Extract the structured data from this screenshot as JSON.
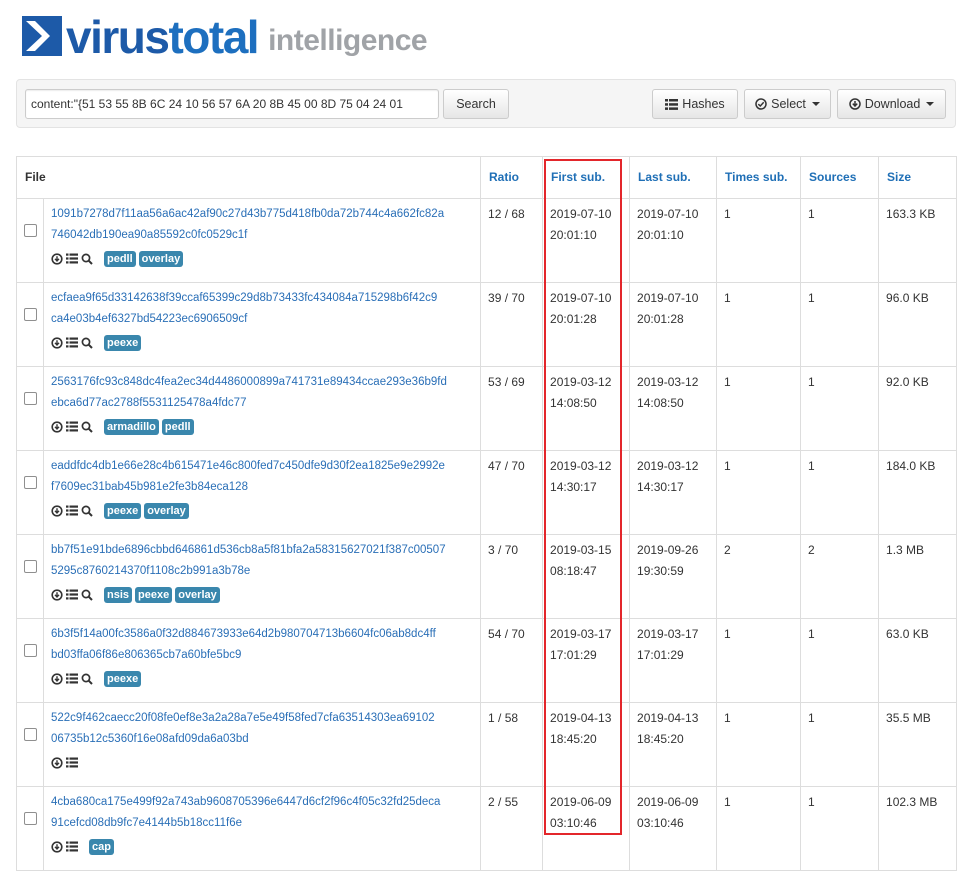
{
  "logo": {
    "brand_a": "virus",
    "brand_b": "total",
    "product": "intelligence"
  },
  "search": {
    "query": "content:\"{51 53 55 8B 6C 24 10 56 57 6A 20 8B 45 00 8D 75 04 24 01",
    "button_label": "Search"
  },
  "toolbar": {
    "hashes_label": "Hashes",
    "select_label": "Select",
    "download_label": "Download"
  },
  "table": {
    "headers": {
      "file": "File",
      "ratio": "Ratio",
      "first_sub": "First sub.",
      "last_sub": "Last sub.",
      "times_sub": "Times sub.",
      "sources": "Sources",
      "size": "Size"
    },
    "rows": [
      {
        "hash_line1": "1091b7278d7f11aa56a6ac42af90c27d43b775d418fb0da72b744c4a662fc82a",
        "hash_line2": "746042db190ea90a85592c0fc0529c1f",
        "tags": [
          "pedll",
          "overlay"
        ],
        "ratio": "12 / 68",
        "first_date": "2019-07-10",
        "first_time": "20:01:10",
        "last_date": "2019-07-10",
        "last_time": "20:01:10",
        "times": "1",
        "sources": "1",
        "size": "163.3 KB",
        "has_search": true
      },
      {
        "hash_line1": "ecfaea9f65d33142638f39ccaf65399c29d8b73433fc434084a715298b6f42c9",
        "hash_line2": "ca4e03b4ef6327bd54223ec6906509cf",
        "tags": [
          "peexe"
        ],
        "ratio": "39 / 70",
        "first_date": "2019-07-10",
        "first_time": "20:01:28",
        "last_date": "2019-07-10",
        "last_time": "20:01:28",
        "times": "1",
        "sources": "1",
        "size": "96.0 KB",
        "has_search": true
      },
      {
        "hash_line1": "2563176fc93c848dc4fea2ec34d4486000899a741731e89434ccae293e36b9fd",
        "hash_line2": "ebca6d77ac2788f5531125478a4fdc77",
        "tags": [
          "armadillo",
          "pedll"
        ],
        "ratio": "53 / 69",
        "first_date": "2019-03-12",
        "first_time": "14:08:50",
        "last_date": "2019-03-12",
        "last_time": "14:08:50",
        "times": "1",
        "sources": "1",
        "size": "92.0 KB",
        "has_search": true
      },
      {
        "hash_line1": "eaddfdc4db1e66e28c4b615471e46c800fed7c450dfe9d30f2ea1825e9e2992e",
        "hash_line2": "f7609ec31bab45b981e2fe3b84eca128",
        "tags": [
          "peexe",
          "overlay"
        ],
        "ratio": "47 / 70",
        "first_date": "2019-03-12",
        "first_time": "14:30:17",
        "last_date": "2019-03-12",
        "last_time": "14:30:17",
        "times": "1",
        "sources": "1",
        "size": "184.0 KB",
        "has_search": true
      },
      {
        "hash_line1": "bb7f51e91bde6896cbbd646861d536cb8a5f81bfa2a58315627021f387c00507",
        "hash_line2": "5295c8760214370f1108c2b991a3b78e",
        "tags": [
          "nsis",
          "peexe",
          "overlay"
        ],
        "ratio": "3 / 70",
        "first_date": "2019-03-15",
        "first_time": "08:18:47",
        "last_date": "2019-09-26",
        "last_time": "19:30:59",
        "times": "2",
        "sources": "2",
        "size": "1.3 MB",
        "has_search": true
      },
      {
        "hash_line1": "6b3f5f14a00fc3586a0f32d884673933e64d2b980704713b6604fc06ab8dc4ff",
        "hash_line2": "bd03ffa06f86e806365cb7a60bfe5bc9",
        "tags": [
          "peexe"
        ],
        "ratio": "54 / 70",
        "first_date": "2019-03-17",
        "first_time": "17:01:29",
        "last_date": "2019-03-17",
        "last_time": "17:01:29",
        "times": "1",
        "sources": "1",
        "size": "63.0 KB",
        "has_search": true
      },
      {
        "hash_line1": "522c9f462caecc20f08fe0ef8e3a2a28a7e5e49f58fed7cfa63514303ea69102",
        "hash_line2": "06735b12c5360f16e08afd09da6a03bd",
        "tags": [],
        "ratio": "1 / 58",
        "first_date": "2019-04-13",
        "first_time": "18:45:20",
        "last_date": "2019-04-13",
        "last_time": "18:45:20",
        "times": "1",
        "sources": "1",
        "size": "35.5 MB",
        "has_search": false
      },
      {
        "hash_line1": "4cba680ca175e499f92a743ab9608705396e6447d6cf2f96c4f05c32fd25deca",
        "hash_line2": "91cefcd08db9fc7e4144b5b18cc11f6e",
        "tags": [
          "cap"
        ],
        "ratio": "2 / 55",
        "first_date": "2019-06-09",
        "first_time": "03:10:46",
        "last_date": "2019-06-09",
        "last_time": "03:10:46",
        "times": "1",
        "sources": "1",
        "size": "102.3 MB",
        "has_search": false
      }
    ]
  },
  "colors": {
    "brand": "#1d5aa8",
    "link": "#2a6fb7",
    "tag": "#3a87ad",
    "highlight": "#e3262b"
  }
}
